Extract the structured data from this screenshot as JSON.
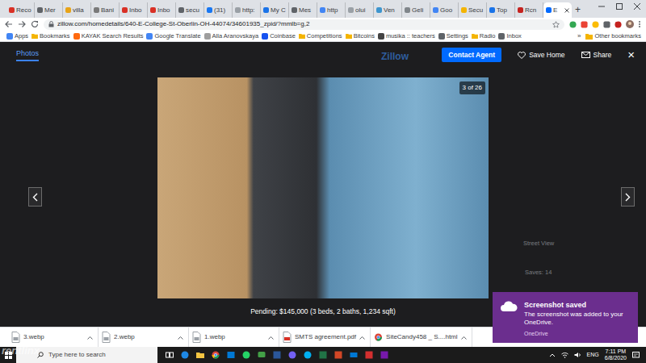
{
  "browser": {
    "tabs": [
      {
        "label": "Reco",
        "color": "#d93025",
        "selected": false
      },
      {
        "label": "Mer",
        "color": "#5f6368",
        "selected": false
      },
      {
        "label": "villa",
        "color": "#e8a317",
        "selected": false
      },
      {
        "label": "Bani",
        "color": "#7a7a7a",
        "selected": false
      },
      {
        "label": "Inbo",
        "color": "#d93025",
        "selected": false
      },
      {
        "label": "Inbo",
        "color": "#d93025",
        "selected": false
      },
      {
        "label": "secu",
        "color": "#5f6368",
        "selected": false
      },
      {
        "label": "(31)",
        "color": "#1877f2",
        "selected": false
      },
      {
        "label": "http:",
        "color": "#9aa0a6",
        "selected": false
      },
      {
        "label": "My C",
        "color": "#1a73e8",
        "selected": false
      },
      {
        "label": "Mes",
        "color": "#5f6368",
        "selected": false
      },
      {
        "label": "http",
        "color": "#4285f4",
        "selected": false
      },
      {
        "label": "olui",
        "color": "#9aa0a6",
        "selected": false
      },
      {
        "label": "Ven",
        "color": "#3d95ce",
        "selected": false
      },
      {
        "label": "Geli",
        "color": "#80868b",
        "selected": false
      },
      {
        "label": "Goo",
        "color": "#4285f4",
        "selected": false
      },
      {
        "label": "Secu",
        "color": "#f4b400",
        "selected": false
      },
      {
        "label": "Top",
        "color": "#1a73e8",
        "selected": false
      },
      {
        "label": "Rcn",
        "color": "#c5221f",
        "selected": false
      },
      {
        "label": "E",
        "color": "#006aff",
        "selected": true
      }
    ],
    "new_tab": "+",
    "address": "zillow.com/homedetails/640-E-College-St-Oberlin-OH-44074/34601935_zpid/?mmlb=g,2",
    "bookmarks": [
      {
        "label": "Apps",
        "kind": "site",
        "color": "#4285f4"
      },
      {
        "label": "Bookmarks",
        "kind": "folder",
        "color": "#f4b400"
      },
      {
        "label": "KAYAK Search Results",
        "kind": "site",
        "color": "#ff690f"
      },
      {
        "label": "Google Translate",
        "kind": "site",
        "color": "#4285f4"
      },
      {
        "label": "Alla Aranovskaya",
        "kind": "site",
        "color": "#9e9e9e"
      },
      {
        "label": "Coinbase",
        "kind": "site",
        "color": "#1652f0"
      },
      {
        "label": "Competitions",
        "kind": "folder",
        "color": "#f4b400"
      },
      {
        "label": "Bitcoins",
        "kind": "folder",
        "color": "#f4b400"
      },
      {
        "label": "musika :: teachers",
        "kind": "site",
        "color": "#444444"
      },
      {
        "label": "Settings",
        "kind": "site",
        "color": "#5f6368"
      },
      {
        "label": "Radio",
        "kind": "folder",
        "color": "#f4b400"
      },
      {
        "label": "Inbox",
        "kind": "site",
        "color": "#5f6368"
      }
    ],
    "more": "»",
    "other_bookmarks": "Other bookmarks"
  },
  "page_behind": {
    "logo": "Zillow",
    "street_view": "Street View",
    "saves": "Saves: 14"
  },
  "viewer": {
    "tab": "Photos",
    "contact": "Contact Agent",
    "save": "Save Home",
    "share": "Share",
    "close": "×",
    "counter": "3 of 26",
    "caption": "Pending: $145,000 (3 beds, 2 baths, 1,234 sqft)",
    "watermark": "rentlinx"
  },
  "downloads": [
    {
      "name": "3.webp",
      "kind": "image"
    },
    {
      "name": "2.webp",
      "kind": "image"
    },
    {
      "name": "1.webp",
      "kind": "image"
    },
    {
      "name": "SMTS agreement.pdf",
      "kind": "pdf"
    },
    {
      "name": "SiteCandy458 _ S....html",
      "kind": "html"
    }
  ],
  "toast": {
    "title": "Screenshot saved",
    "body": "The screenshot was added to your OneDrive.",
    "app": "OneDrive"
  },
  "taskbar": {
    "search": "Type here to search",
    "lang": "ENG",
    "time": "7:11 PM",
    "date": "6/8/2020"
  }
}
